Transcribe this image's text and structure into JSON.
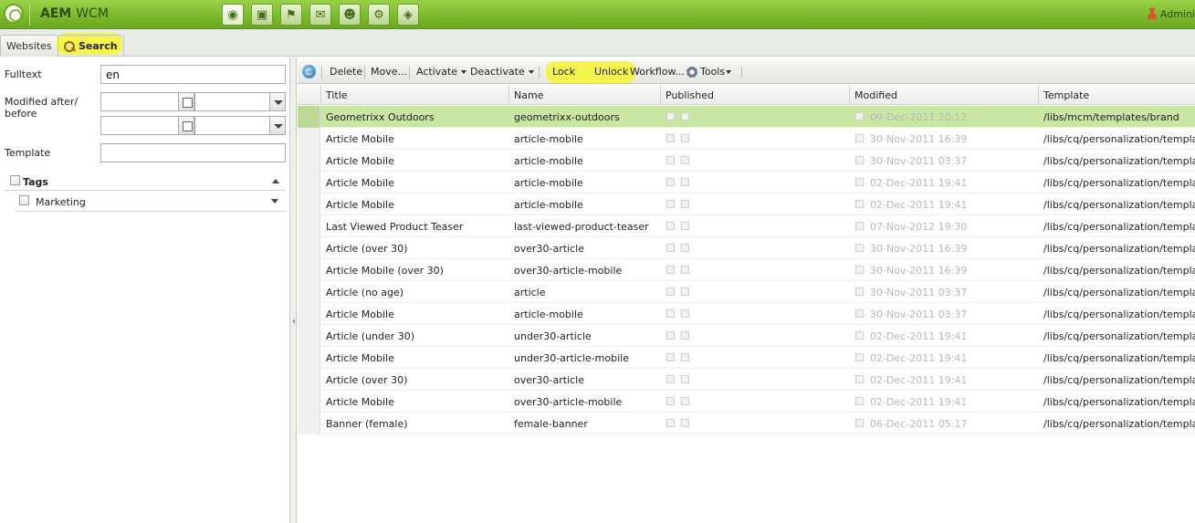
{
  "app": {
    "title_bold": "AEM",
    "title_rest": "WCM",
    "user": "Admini"
  },
  "nav_icons": [
    "websites-icon",
    "digital-assets-icon",
    "campaigns-icon",
    "inbox-icon",
    "users-icon",
    "tools-icon",
    "tagging-icon"
  ],
  "tabs": {
    "websites": "Websites",
    "search": "Search"
  },
  "search_form": {
    "fulltext_label": "Fulltext",
    "fulltext_value": "en",
    "modified_label": "Modified after/\nbefore",
    "template_label": "Template",
    "template_value": "",
    "tags_label": "Tags",
    "tag_item": "Marketing"
  },
  "toolbar": {
    "delete": "Delete",
    "move": "Move...",
    "activate": "Activate",
    "deactivate": "Deactivate",
    "lock": "Lock",
    "unlock": "Unlock",
    "workflow": "Workflow...",
    "tools": "Tools"
  },
  "grid": {
    "columns": [
      "Title",
      "Name",
      "Published",
      "Modified",
      "Template"
    ],
    "rows": [
      {
        "title": "Geometrixx Outdoors",
        "name": "geometrixx-outdoors",
        "modified": "09-Dec-2011 20:12",
        "template": "/libs/mcm/templates/brand"
      },
      {
        "title": "Article Mobile",
        "name": "article-mobile",
        "modified": "30-Nov-2011 16:39",
        "template": "/libs/cq/personalization/templates/"
      },
      {
        "title": "Article Mobile",
        "name": "article-mobile",
        "modified": "30-Nov-2011 03:37",
        "template": "/libs/cq/personalization/templates/"
      },
      {
        "title": "Article Mobile",
        "name": "article-mobile",
        "modified": "02-Dec-2011 19:41",
        "template": "/libs/cq/personalization/templates/"
      },
      {
        "title": "Article Mobile",
        "name": "article-mobile",
        "modified": "02-Dec-2011 19:41",
        "template": "/libs/cq/personalization/templates/"
      },
      {
        "title": "Last Viewed Product Teaser",
        "name": "last-viewed-product-teaser",
        "modified": "07-Nov-2012 19:30",
        "template": "/libs/cq/personalization/templates/"
      },
      {
        "title": "Article (over 30)",
        "name": "over30-article",
        "modified": "30-Nov-2011 16:39",
        "template": "/libs/cq/personalization/templates/"
      },
      {
        "title": "Article Mobile (over 30)",
        "name": "over30-article-mobile",
        "modified": "30-Nov-2011 16:39",
        "template": "/libs/cq/personalization/templates/"
      },
      {
        "title": "Article (no age)",
        "name": "article",
        "modified": "30-Nov-2011 03:37",
        "template": "/libs/cq/personalization/templates/"
      },
      {
        "title": "Article Mobile",
        "name": "article-mobile",
        "modified": "30-Nov-2011 03:37",
        "template": "/libs/cq/personalization/templates/"
      },
      {
        "title": "Article (under 30)",
        "name": "under30-article",
        "modified": "02-Dec-2011 19:41",
        "template": "/libs/cq/personalization/templates/"
      },
      {
        "title": "Article Mobile",
        "name": "under30-article-mobile",
        "modified": "02-Dec-2011 19:41",
        "template": "/libs/cq/personalization/templates/"
      },
      {
        "title": "Article (over 30)",
        "name": "over30-article",
        "modified": "02-Dec-2011 19:41",
        "template": "/libs/cq/personalization/templates/"
      },
      {
        "title": "Article Mobile",
        "name": "over30-article-mobile",
        "modified": "02-Dec-2011 19:41",
        "template": "/libs/cq/personalization/templates/"
      },
      {
        "title": "Banner (female)",
        "name": "female-banner",
        "modified": "06-Dec-2011 05:17",
        "template": "/libs/cq/personalization/templates/"
      }
    ]
  },
  "colors": {
    "highlight": "#f6f34d",
    "topbar": "#7cbb2c",
    "selected_row": "#c9e6a3"
  }
}
